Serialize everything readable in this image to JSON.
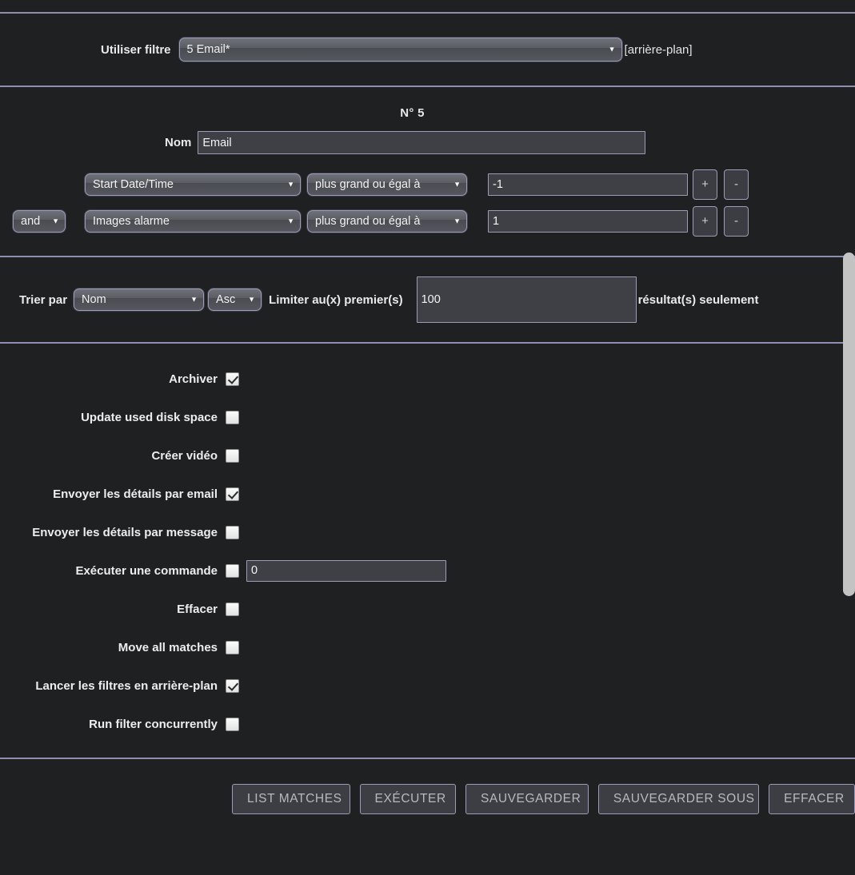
{
  "filter_bar": {
    "label": "Utiliser filtre",
    "selected": "5 Email*",
    "note": "[arrière-plan]"
  },
  "detail": {
    "number_title": "N° 5",
    "name_label": "Nom",
    "name_value": "Email",
    "conditions": [
      {
        "conjunction": "",
        "field": "Start Date/Time",
        "operator": "plus grand ou égal à",
        "value": "-1",
        "add_label": "+",
        "remove_label": "-"
      },
      {
        "conjunction": "and",
        "field": "Images alarme",
        "operator": "plus grand ou égal à",
        "value": "1",
        "add_label": "+",
        "remove_label": "-"
      }
    ]
  },
  "sort": {
    "sort_by_label": "Trier par",
    "sort_field": "Nom",
    "sort_direction": "Asc",
    "limit_label": "Limiter au(x) premier(s)",
    "limit_value": "100",
    "limit_suffix": "résultat(s) seulement"
  },
  "actions": [
    {
      "label": "Archiver",
      "checked": true,
      "input": null
    },
    {
      "label": "Update used disk space",
      "checked": false,
      "input": null
    },
    {
      "label": "Créer vidéo",
      "checked": false,
      "input": null
    },
    {
      "label": "Envoyer les détails par email",
      "checked": true,
      "input": null
    },
    {
      "label": "Envoyer les détails par message",
      "checked": false,
      "input": null
    },
    {
      "label": "Exécuter une commande",
      "checked": false,
      "input": "0"
    },
    {
      "label": "Effacer",
      "checked": false,
      "input": null
    },
    {
      "label": "Move all matches",
      "checked": false,
      "input": null
    },
    {
      "label": "Lancer les filtres en arrière-plan",
      "checked": true,
      "input": null
    },
    {
      "label": "Run filter concurrently",
      "checked": false,
      "input": null
    }
  ],
  "buttons": [
    {
      "label": "LIST MATCHES"
    },
    {
      "label": "EXÉCUTER"
    },
    {
      "label": "SAUVEGARDER"
    },
    {
      "label": "SAUVEGARDER SOUS"
    },
    {
      "label": "EFFACER"
    }
  ],
  "colors": {
    "background": "#1f2022",
    "separator": "#8c8fae",
    "border": "#9a9cb8",
    "input_bg": "#3f4045",
    "text": "#e8e8e8",
    "scrollbar": "#c3c3c3"
  }
}
